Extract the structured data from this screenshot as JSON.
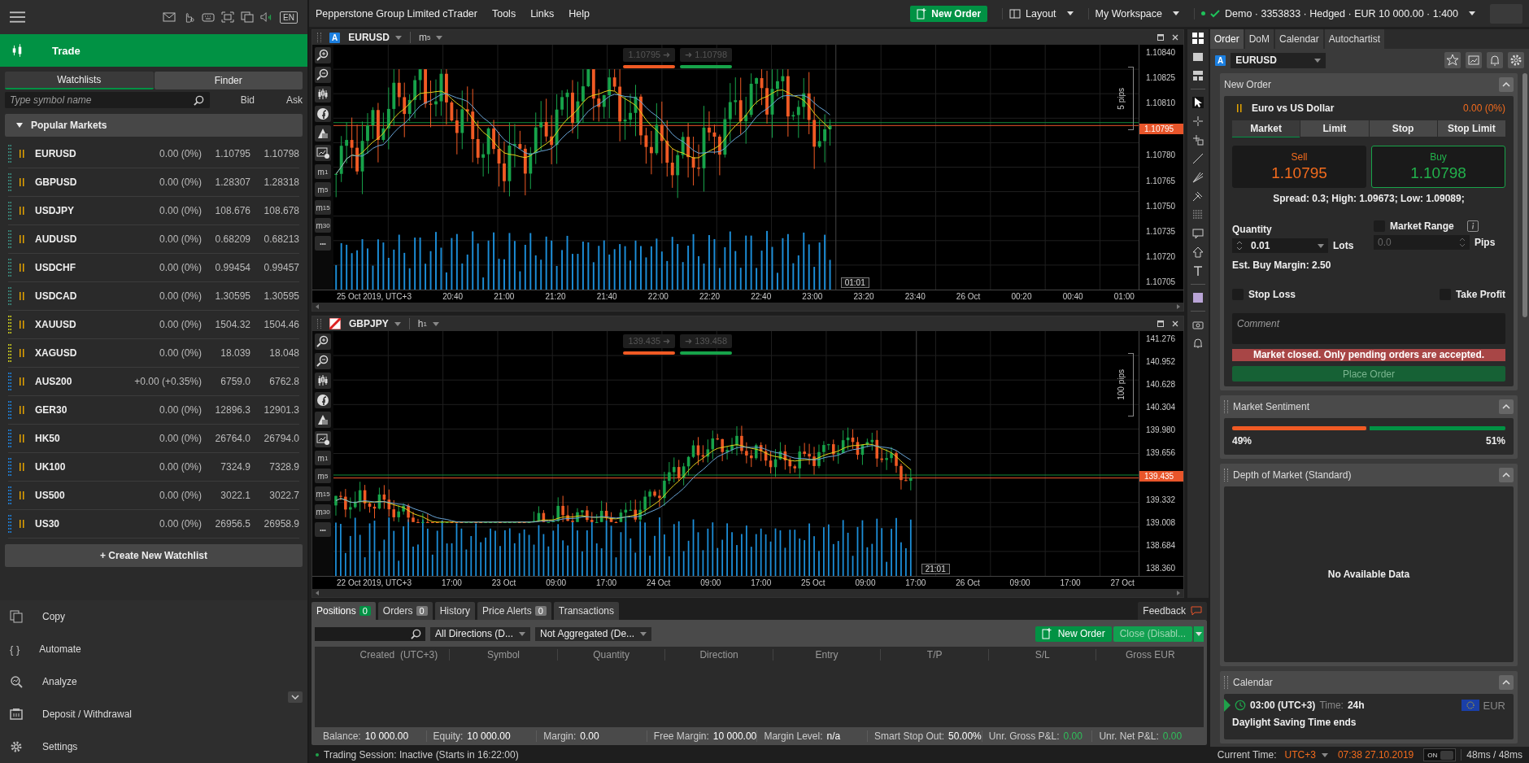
{
  "menubar": {
    "title": "Pepperstone Group Limited cTrader",
    "menus": [
      "Tools",
      "Links",
      "Help"
    ],
    "new_order": "New Order",
    "layout": "Layout",
    "workspace": "My Workspace",
    "account": "Demo · 3353833 · Hedged · EUR 10 000.00 · 1:400",
    "connected": true
  },
  "sidebar": {
    "language": "EN",
    "section": "Trade",
    "subtabs": [
      {
        "label": "Watchlists",
        "selected": true
      },
      {
        "label": "Finder",
        "selected": false
      }
    ],
    "search": {
      "placeholder": "Type symbol name"
    },
    "columns": [
      "Bid",
      "Ask"
    ],
    "group": {
      "label": "Popular Markets",
      "expanded": true
    },
    "markets": [
      {
        "symbol": "EURUSD",
        "change": "0.00 (0%)",
        "bid": "1.10795",
        "ask": "1.10798",
        "color": "#3a8a7e"
      },
      {
        "symbol": "GBPUSD",
        "change": "0.00 (0%)",
        "bid": "1.28307",
        "ask": "1.28318",
        "color": "#3a8a7e"
      },
      {
        "symbol": "USDJPY",
        "change": "0.00 (0%)",
        "bid": "108.676",
        "ask": "108.678",
        "color": "#3a8a7e"
      },
      {
        "symbol": "AUDUSD",
        "change": "0.00 (0%)",
        "bid": "0.68209",
        "ask": "0.68213",
        "color": "#3a8a7e"
      },
      {
        "symbol": "USDCHF",
        "change": "0.00 (0%)",
        "bid": "0.99454",
        "ask": "0.99457",
        "color": "#3a8a7e"
      },
      {
        "symbol": "USDCAD",
        "change": "0.00 (0%)",
        "bid": "1.30595",
        "ask": "1.30595",
        "color": "#3a8a7e"
      },
      {
        "symbol": "XAUUSD",
        "change": "0.00 (0%)",
        "bid": "1504.32",
        "ask": "1504.46",
        "color": "#c8c81e"
      },
      {
        "symbol": "XAGUSD",
        "change": "0.00 (0%)",
        "bid": "18.039",
        "ask": "18.048",
        "color": "#c8c81e"
      },
      {
        "symbol": "AUS200",
        "change": "+0.00 (+0.35%)",
        "bid": "6759.0",
        "ask": "6762.8",
        "color": "#1e7fd8"
      },
      {
        "symbol": "GER30",
        "change": "0.00 (0%)",
        "bid": "12896.3",
        "ask": "12901.3",
        "color": "#1e7fd8"
      },
      {
        "symbol": "HK50",
        "change": "0.00 (0%)",
        "bid": "26764.0",
        "ask": "26794.0",
        "color": "#1e7fd8"
      },
      {
        "symbol": "UK100",
        "change": "0.00 (0%)",
        "bid": "7324.9",
        "ask": "7328.9",
        "color": "#1e7fd8"
      },
      {
        "symbol": "US500",
        "change": "0.00 (0%)",
        "bid": "3022.1",
        "ask": "3022.7",
        "color": "#1e7fd8"
      },
      {
        "symbol": "US30",
        "change": "0.00 (0%)",
        "bid": "26956.5",
        "ask": "26958.9",
        "color": "#1e7fd8"
      }
    ],
    "create_button": "+ Create New Watchlist",
    "nav": [
      {
        "label": "Copy",
        "kind": "copy"
      },
      {
        "label": "Automate",
        "kind": "automate",
        "glyph": "{ }"
      },
      {
        "label": "Analyze",
        "kind": "analyze"
      },
      {
        "label": "Deposit / Withdrawal",
        "kind": "deposit"
      },
      {
        "label": "Settings",
        "kind": "settings"
      }
    ]
  },
  "charts": [
    {
      "symbol": "EURUSD",
      "badge": {
        "kind": "letter",
        "text": "A"
      },
      "timeframe": {
        "unit": "m",
        "value": "5"
      },
      "sell": "1.10795",
      "buy": "1.10798",
      "quick_arrow": "➜",
      "range_label": "5 pips",
      "price_ticks": [
        "1.10840",
        "1.10825",
        "1.10810",
        "1.10780",
        "1.10765",
        "1.10750",
        "1.10735",
        "1.10720",
        "1.10705"
      ],
      "current_price": "1.10795",
      "time_labels": [
        "25 Oct 2019, UTC+3",
        "20:40",
        "21:00",
        "21:20",
        "21:40",
        "22:00",
        "22:20",
        "22:40",
        "23:00",
        "23:20",
        "23:40",
        "26 Oct",
        "00:20",
        "00:40",
        "01:00"
      ],
      "crosshair_time": "01:01",
      "timeframe_buttons": [
        {
          "unit": "m",
          "value": "1"
        },
        {
          "unit": "m",
          "value": "5"
        },
        {
          "unit": "m",
          "value": "15"
        },
        {
          "unit": "m",
          "value": "30"
        }
      ],
      "more": "•••"
    },
    {
      "symbol": "GBPJPY",
      "badge": {
        "kind": "flag"
      },
      "timeframe": {
        "unit": "h",
        "value": "1"
      },
      "sell": "139.435",
      "buy": "139.458",
      "quick_arrow": "➜",
      "range_label": "100 pips",
      "price_ticks": [
        "141.276",
        "140.952",
        "140.628",
        "140.304",
        "139.980",
        "139.656",
        "139.332",
        "139.008",
        "138.684",
        "138.360"
      ],
      "current_price": "139.435",
      "time_labels": [
        "22 Oct 2019, UTC+3",
        "17:00",
        "23 Oct",
        "09:00",
        "17:00",
        "24 Oct",
        "09:00",
        "17:00",
        "25 Oct",
        "09:00",
        "17:00",
        "26 Oct",
        "09:00",
        "17:00",
        "27 Oct"
      ],
      "crosshair_time": "21:01",
      "timeframe_buttons": [
        {
          "unit": "m",
          "value": "1"
        },
        {
          "unit": "m",
          "value": "5"
        },
        {
          "unit": "m",
          "value": "15"
        },
        {
          "unit": "m",
          "value": "30"
        }
      ],
      "more": "•••"
    }
  ],
  "order_panel": {
    "tabs": [
      {
        "label": "Order",
        "selected": true
      },
      {
        "label": "DoM",
        "selected": false
      },
      {
        "label": "Calendar",
        "selected": false
      },
      {
        "label": "Autochartist",
        "selected": false
      }
    ],
    "badge": "A",
    "symbol": "EURUSD",
    "new_order": {
      "title": "New Order",
      "instrument": "Euro vs US Dollar",
      "change": "0.00 (0%)",
      "order_types": [
        {
          "label": "Market",
          "selected": true
        },
        {
          "label": "Limit",
          "selected": false
        },
        {
          "label": "Stop",
          "selected": false
        },
        {
          "label": "Stop Limit",
          "selected": false
        }
      ],
      "sell_label": "Sell",
      "sell_price": "1.10795",
      "buy_label": "Buy",
      "buy_price": "1.10798",
      "stats": "Spread: 0.3; High: 1.09673; Low: 1.09089;",
      "quantity_label": "Quantity",
      "quantity": "0.01",
      "unit": "Lots",
      "market_range": {
        "label": "Market Range",
        "checked": false
      },
      "range_value": "0.0",
      "range_unit": "Pips",
      "margin": "Est. Buy Margin: 2.50",
      "stop_loss": {
        "label": "Stop Loss",
        "checked": false
      },
      "take_profit": {
        "label": "Take Profit",
        "checked": false
      },
      "comment": {
        "placeholder": "Comment"
      },
      "warning": "Market closed. Only pending orders are accepted.",
      "place": "Place Order"
    },
    "sentiment": {
      "title": "Market Sentiment",
      "sell": {
        "text": "49%",
        "level": 0.49
      },
      "buy": {
        "text": "51%",
        "level": 0.51
      }
    },
    "depth": {
      "title": "Depth of Market (Standard)",
      "empty": "No Available Data"
    },
    "calendar": {
      "title": "Calendar",
      "time": "03:00 (UTC+3)",
      "time_label": "Time:",
      "period": "24h",
      "currency": "EUR",
      "event": "Daylight Saving Time ends"
    }
  },
  "bottom": {
    "tabs": [
      {
        "label": "Positions",
        "count": "0",
        "selected": true
      },
      {
        "label": "Orders",
        "count": "0",
        "selected": false
      },
      {
        "label": "History",
        "selected": false
      },
      {
        "label": "Price Alerts",
        "count": "0",
        "selected": false
      },
      {
        "label": "Transactions",
        "selected": false
      }
    ],
    "feedback": "Feedback",
    "filters": [
      "All Directions (D...",
      "Not Aggregated (De..."
    ],
    "new_order": "New Order",
    "close": "Close (Disabl...",
    "columns": [
      "Created  (UTC+3)",
      "Symbol",
      "Quantity",
      "Direction",
      "Entry",
      "T/P",
      "S/L",
      "Gross EUR"
    ],
    "summary": [
      {
        "label": "Balance:",
        "value": "10 000.00",
        "kind": "plain"
      },
      {
        "label": "Equity:",
        "value": "10 000.00",
        "kind": "plain"
      },
      {
        "label": "Margin:",
        "value": "0.00",
        "kind": "plain"
      },
      {
        "label": "Free Margin:",
        "value": "10 000.00",
        "kind": "plain"
      },
      {
        "label": "Margin Level:",
        "value": "n/a",
        "kind": "plain"
      },
      {
        "label": "Smart Stop Out:",
        "value": "50.00%",
        "kind": "plain"
      },
      {
        "label": "Unr. Gross P&L:",
        "value": "0.00",
        "kind": "pnl"
      },
      {
        "label": "Unr. Net P&L:",
        "value": "0.00",
        "kind": "pnl"
      }
    ]
  },
  "status": {
    "session": "Trading Session: Inactive (Starts in 16:22:00)",
    "time_label": "Current Time:",
    "timezone": "UTC+3",
    "datetime": "07:38 27.10.2019",
    "toggle": {
      "label": "ON",
      "on": true
    },
    "latency": "48ms / 48ms"
  }
}
